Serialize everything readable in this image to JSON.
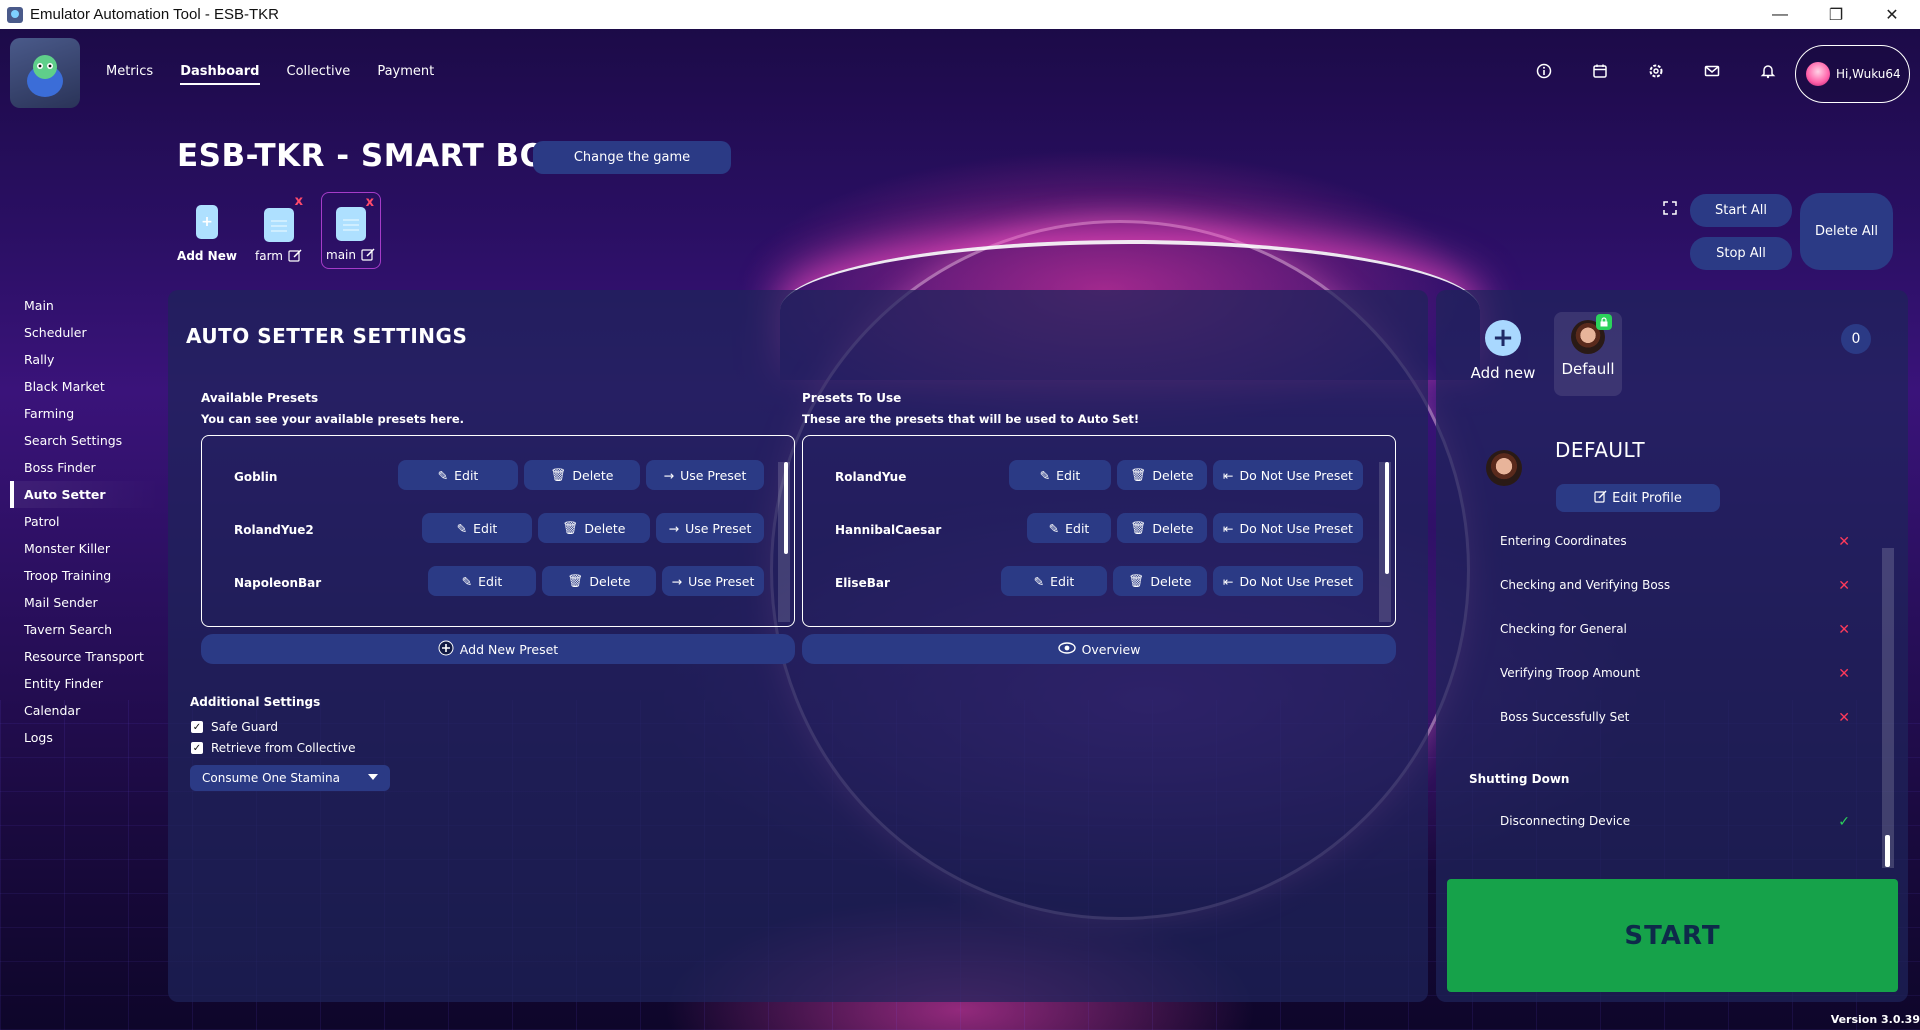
{
  "window": {
    "title": "Emulator Automation Tool - ESB-TKR"
  },
  "nav": {
    "tabs": [
      {
        "label": "Metrics"
      },
      {
        "label": "Dashboard"
      },
      {
        "label": "Collective"
      },
      {
        "label": "Payment"
      }
    ],
    "active_tab": "Dashboard",
    "icons": [
      "info-icon",
      "calendar-icon",
      "settings-icon",
      "mail-icon",
      "bell-icon"
    ],
    "user_greeting": "Hi,Wuku64"
  },
  "header": {
    "title": "ESB-TKR - SMART BOT",
    "change_game": "Change the game",
    "bot_tabs": [
      {
        "label": "Add New"
      },
      {
        "label": "farm"
      },
      {
        "label": "main"
      }
    ],
    "start_all": "Start All",
    "stop_all": "Stop All",
    "delete_all": "Delete All"
  },
  "sidebar": {
    "items": [
      {
        "label": "Main"
      },
      {
        "label": "Scheduler"
      },
      {
        "label": "Rally"
      },
      {
        "label": "Black Market"
      },
      {
        "label": "Farming"
      },
      {
        "label": "Search Settings"
      },
      {
        "label": "Boss Finder"
      },
      {
        "label": "Auto Setter"
      },
      {
        "label": "Patrol"
      },
      {
        "label": "Monster Killer"
      },
      {
        "label": "Troop Training"
      },
      {
        "label": "Mail Sender"
      },
      {
        "label": "Tavern Search"
      },
      {
        "label": "Resource Transport"
      },
      {
        "label": "Entity Finder"
      },
      {
        "label": "Calendar"
      },
      {
        "label": "Logs"
      }
    ],
    "active": "Auto Setter"
  },
  "main": {
    "title": "AUTO SETTER SETTINGS",
    "available": {
      "heading": "Available Presets",
      "sub": "You can see your available presets here.",
      "rows": [
        {
          "name": "Goblin",
          "edit": "Edit",
          "delete": "Delete",
          "action": "Use Preset"
        },
        {
          "name": "RolandYue2",
          "edit": "Edit",
          "delete": "Delete",
          "action": "Use Preset"
        },
        {
          "name": "NapoleonBar",
          "edit": "Edit",
          "delete": "Delete",
          "action": "Use Preset"
        }
      ],
      "add_button": "Add New Preset"
    },
    "to_use": {
      "heading": "Presets To Use",
      "sub": "These are the presets that will be used to Auto Set!",
      "rows": [
        {
          "name": "RolandYue",
          "edit": "Edit",
          "delete": "Delete",
          "action": "Do Not Use Preset"
        },
        {
          "name": "HannibalCaesar",
          "edit": "Edit",
          "delete": "Delete",
          "action": "Do Not Use Preset"
        },
        {
          "name": "EliseBar",
          "edit": "Edit",
          "delete": "Delete",
          "action": "Do Not Use Preset"
        }
      ],
      "overview_button": "Overview"
    },
    "additional": {
      "heading": "Additional Settings",
      "safe_guard": "Safe Guard",
      "safe_guard_checked": true,
      "retrieve": "Retrieve from Collective",
      "retrieve_checked": true,
      "stamina_select": "Consume One Stamina"
    }
  },
  "profile": {
    "add_new": "Add new",
    "default_tab": "Defaull",
    "count": "0",
    "title": "DEFAULT",
    "edit_profile": "Edit Profile",
    "tasks": [
      {
        "label": "Entering Coordinates",
        "status": "x"
      },
      {
        "label": "Checking and Verifying Boss",
        "status": "x"
      },
      {
        "label": "Checking for General",
        "status": "x"
      },
      {
        "label": "Verifying Troop Amount",
        "status": "x"
      },
      {
        "label": "Boss Successfully Set",
        "status": "x"
      }
    ],
    "shutdown_heading": "Shutting Down",
    "shutdown_tasks": [
      {
        "label": "Disconnecting Device",
        "status": "ok"
      }
    ],
    "start": "START"
  },
  "footer": {
    "version": "Version 3.0.39"
  },
  "colors": {
    "button": "#2b3a85",
    "start": "#16a24a",
    "error": "#ff3a5a",
    "success": "#2bd25b"
  }
}
